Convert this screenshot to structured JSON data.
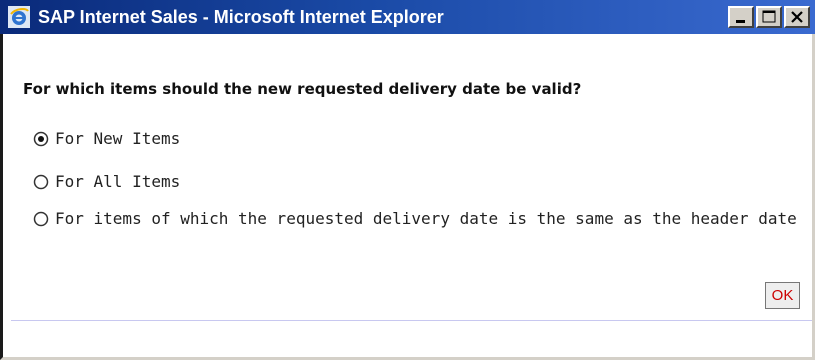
{
  "window": {
    "title": "SAP Internet Sales - Microsoft Internet Explorer",
    "icon": "internet-explorer-icon",
    "controls": [
      "minimize-icon",
      "maximize-icon",
      "close-icon"
    ]
  },
  "dialog": {
    "question": "For which items should the new requested delivery date be valid?",
    "options": [
      {
        "label": "For New Items",
        "selected": true
      },
      {
        "label": "For All Items",
        "selected": false
      },
      {
        "label": "For items of which the requested delivery date is the same as the header date",
        "selected": false
      }
    ],
    "ok_label": "OK"
  },
  "colors": {
    "titlebar_dark": "#0a2a7a",
    "titlebar_light": "#3a6ad0",
    "ok_text": "#cc0000"
  }
}
